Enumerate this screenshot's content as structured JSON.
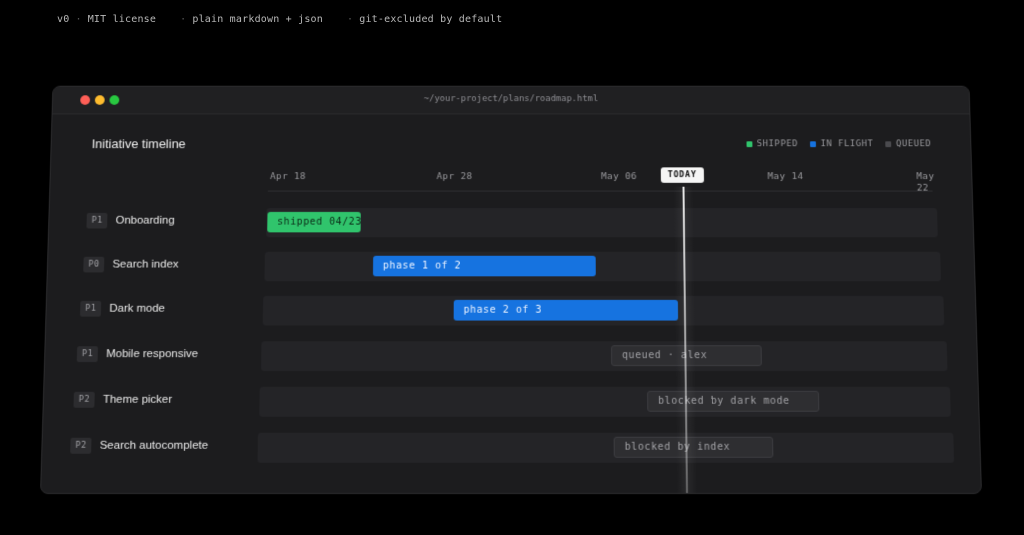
{
  "caption": {
    "version": "v0",
    "license": "MIT license",
    "format": "plain markdown + json",
    "git": "git-excluded by default"
  },
  "window": {
    "path": "~/your-project/plans/roadmap.html",
    "title": "Initiative timeline"
  },
  "legend": [
    {
      "label": "SHIPPED",
      "color": "#30c46c"
    },
    {
      "label": "IN FLIGHT",
      "color": "#1673e0"
    },
    {
      "label": "QUEUED",
      "color": "#4a4a4e"
    }
  ],
  "axis": {
    "ticks": [
      "Apr 18",
      "Apr 28",
      "May 06",
      "May 14",
      "May 22"
    ],
    "today_label": "TODAY"
  },
  "rows": [
    {
      "priority": "P1",
      "name": "Onboarding",
      "status": "shipped",
      "bar_label": "shipped 04/23"
    },
    {
      "priority": "P0",
      "name": "Search index",
      "status": "inflight",
      "bar_label": "phase 1 of 2"
    },
    {
      "priority": "P1",
      "name": "Dark mode",
      "status": "inflight",
      "bar_label": "phase 2 of 3"
    },
    {
      "priority": "P1",
      "name": "Mobile responsive",
      "status": "queued",
      "bar_label": "queued · alex"
    },
    {
      "priority": "P2",
      "name": "Theme picker",
      "status": "queued",
      "bar_label": "blocked by dark mode"
    },
    {
      "priority": "P2",
      "name": "Search autocomplete",
      "status": "queued",
      "bar_label": "blocked by index"
    }
  ]
}
